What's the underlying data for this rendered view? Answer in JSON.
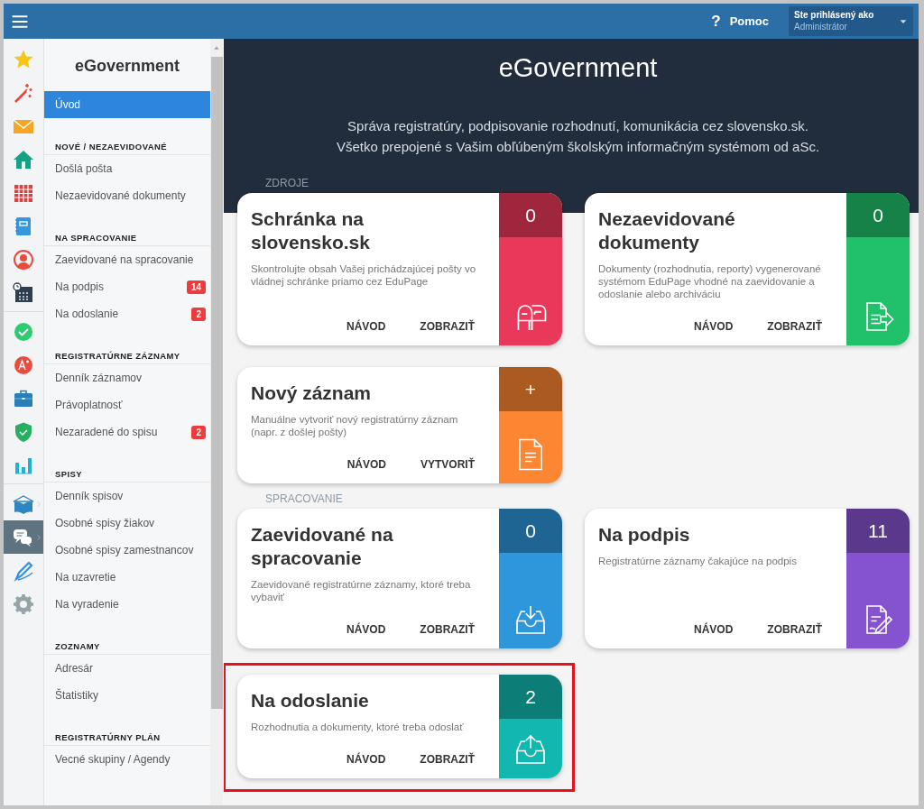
{
  "topbar": {
    "help": {
      "icon_text": "?",
      "label": "Pomoc"
    },
    "user": {
      "caption": "Ste prihlásený ako",
      "name": "Administrátor"
    }
  },
  "rail": [
    [
      {
        "selected": false
      },
      {
        "selected": false
      },
      {
        "selected": false
      },
      {
        "selected": false
      },
      {
        "selected": false
      },
      {
        "selected": false
      },
      {
        "selected": false
      },
      {
        "selected": false
      }
    ],
    [
      {
        "selected": false
      },
      {
        "selected": false
      },
      {
        "selected": false
      },
      {
        "selected": false
      },
      {
        "selected": false
      }
    ],
    [
      {
        "selected": false
      },
      {
        "selected": true
      },
      {
        "selected": false
      },
      {
        "selected": false
      }
    ]
  ],
  "sidebar": {
    "title": "eGovernment",
    "home": {
      "label": "Úvod",
      "selected": true
    },
    "sections": [
      {
        "heading": "NOVÉ / NEZAEVIDOVANÉ",
        "items": [
          {
            "label": "Došlá pošta"
          },
          {
            "label": "Nezaevidované dokumenty"
          }
        ]
      },
      {
        "heading": "NA SPRACOVANIE",
        "items": [
          {
            "label": "Zaevidované na spracovanie"
          },
          {
            "label": "Na podpis",
            "badge": "14"
          },
          {
            "label": "Na odoslanie",
            "badge": "2"
          }
        ]
      },
      {
        "heading": "REGISTRATÚRNE ZÁZNAMY",
        "items": [
          {
            "label": "Denník záznamov"
          },
          {
            "label": "Právoplatnosť"
          },
          {
            "label": "Nezaradené do spisu",
            "badge": "2"
          }
        ]
      },
      {
        "heading": "SPISY",
        "items": [
          {
            "label": "Denník spisov"
          },
          {
            "label": "Osobné spisy žiakov"
          },
          {
            "label": "Osobné spisy zamestnancov"
          },
          {
            "label": "Na uzavretie"
          },
          {
            "label": "Na vyradenie"
          }
        ]
      },
      {
        "heading": "ZOZNAMY",
        "items": [
          {
            "label": "Adresár"
          },
          {
            "label": "Štatistiky"
          }
        ]
      },
      {
        "heading": "REGISTRATÚRNY PLÁN",
        "items": [
          {
            "label": "Vecné skupiny / Agendy"
          }
        ]
      }
    ]
  },
  "main": {
    "title": "eGovernment",
    "subtitle": [
      "Správa registratúry, podpisovanie rozhodnutí, komunikácia cez slovensko.sk.",
      "Všetko prepojené s Vašim obľúbeným školským informačným systémom od aSc."
    ],
    "groups": [
      {
        "label": "ZDROJE",
        "cards": [
          {
            "title": "Schránka na slovensko.sk",
            "description": "Skontrolujte obsah Vašej prichádzajúcej pošty vo vládnej schránke priamo cez EduPage",
            "count": "0",
            "color": "#e9395a",
            "actions": [
              "NÁVOD",
              "ZOBRAZIŤ"
            ],
            "highlighted": false
          },
          {
            "title": "Nezaevidované dokumenty",
            "description": "Dokumenty (rozhodnutia, reporty) vygenerované systémom EduPage vhodné na zaevidovanie a odoslanie alebo archiváciu",
            "count": "0",
            "color": "#21c06a",
            "actions": [
              "NÁVOD",
              "ZOBRAZIŤ"
            ],
            "highlighted": false
          },
          {
            "title": "Nový záznam",
            "description": "Manuálne vytvoriť nový registratúrny záznam (napr. z došlej pošty)",
            "count": "+",
            "color": "#fd8632",
            "actions": [
              "NÁVOD",
              "VYTVORIŤ"
            ],
            "highlighted": false
          }
        ]
      },
      {
        "label": "SPRACOVANIE",
        "cards": [
          {
            "title": "Zaevidované na spracovanie",
            "description": "Zaevidované registratúrne záznamy, ktoré treba vybaviť",
            "count": "0",
            "color": "#2e96da",
            "actions": [
              "NÁVOD",
              "ZOBRAZIŤ"
            ],
            "highlighted": false
          },
          {
            "title": "Na podpis",
            "description": "Registratúrne záznamy čakajúce na podpis",
            "count": "11",
            "color": "#8553cf",
            "actions": [
              "NÁVOD",
              "ZOBRAZIŤ"
            ],
            "highlighted": false
          },
          {
            "title": "Na odoslanie",
            "description": "Rozhodnutia a dokumenty, ktoré treba odoslať",
            "count": "2",
            "color": "#12b8b0",
            "actions": [
              "NÁVOD",
              "ZOBRAZIŤ"
            ],
            "highlighted": true
          }
        ]
      }
    ]
  }
}
